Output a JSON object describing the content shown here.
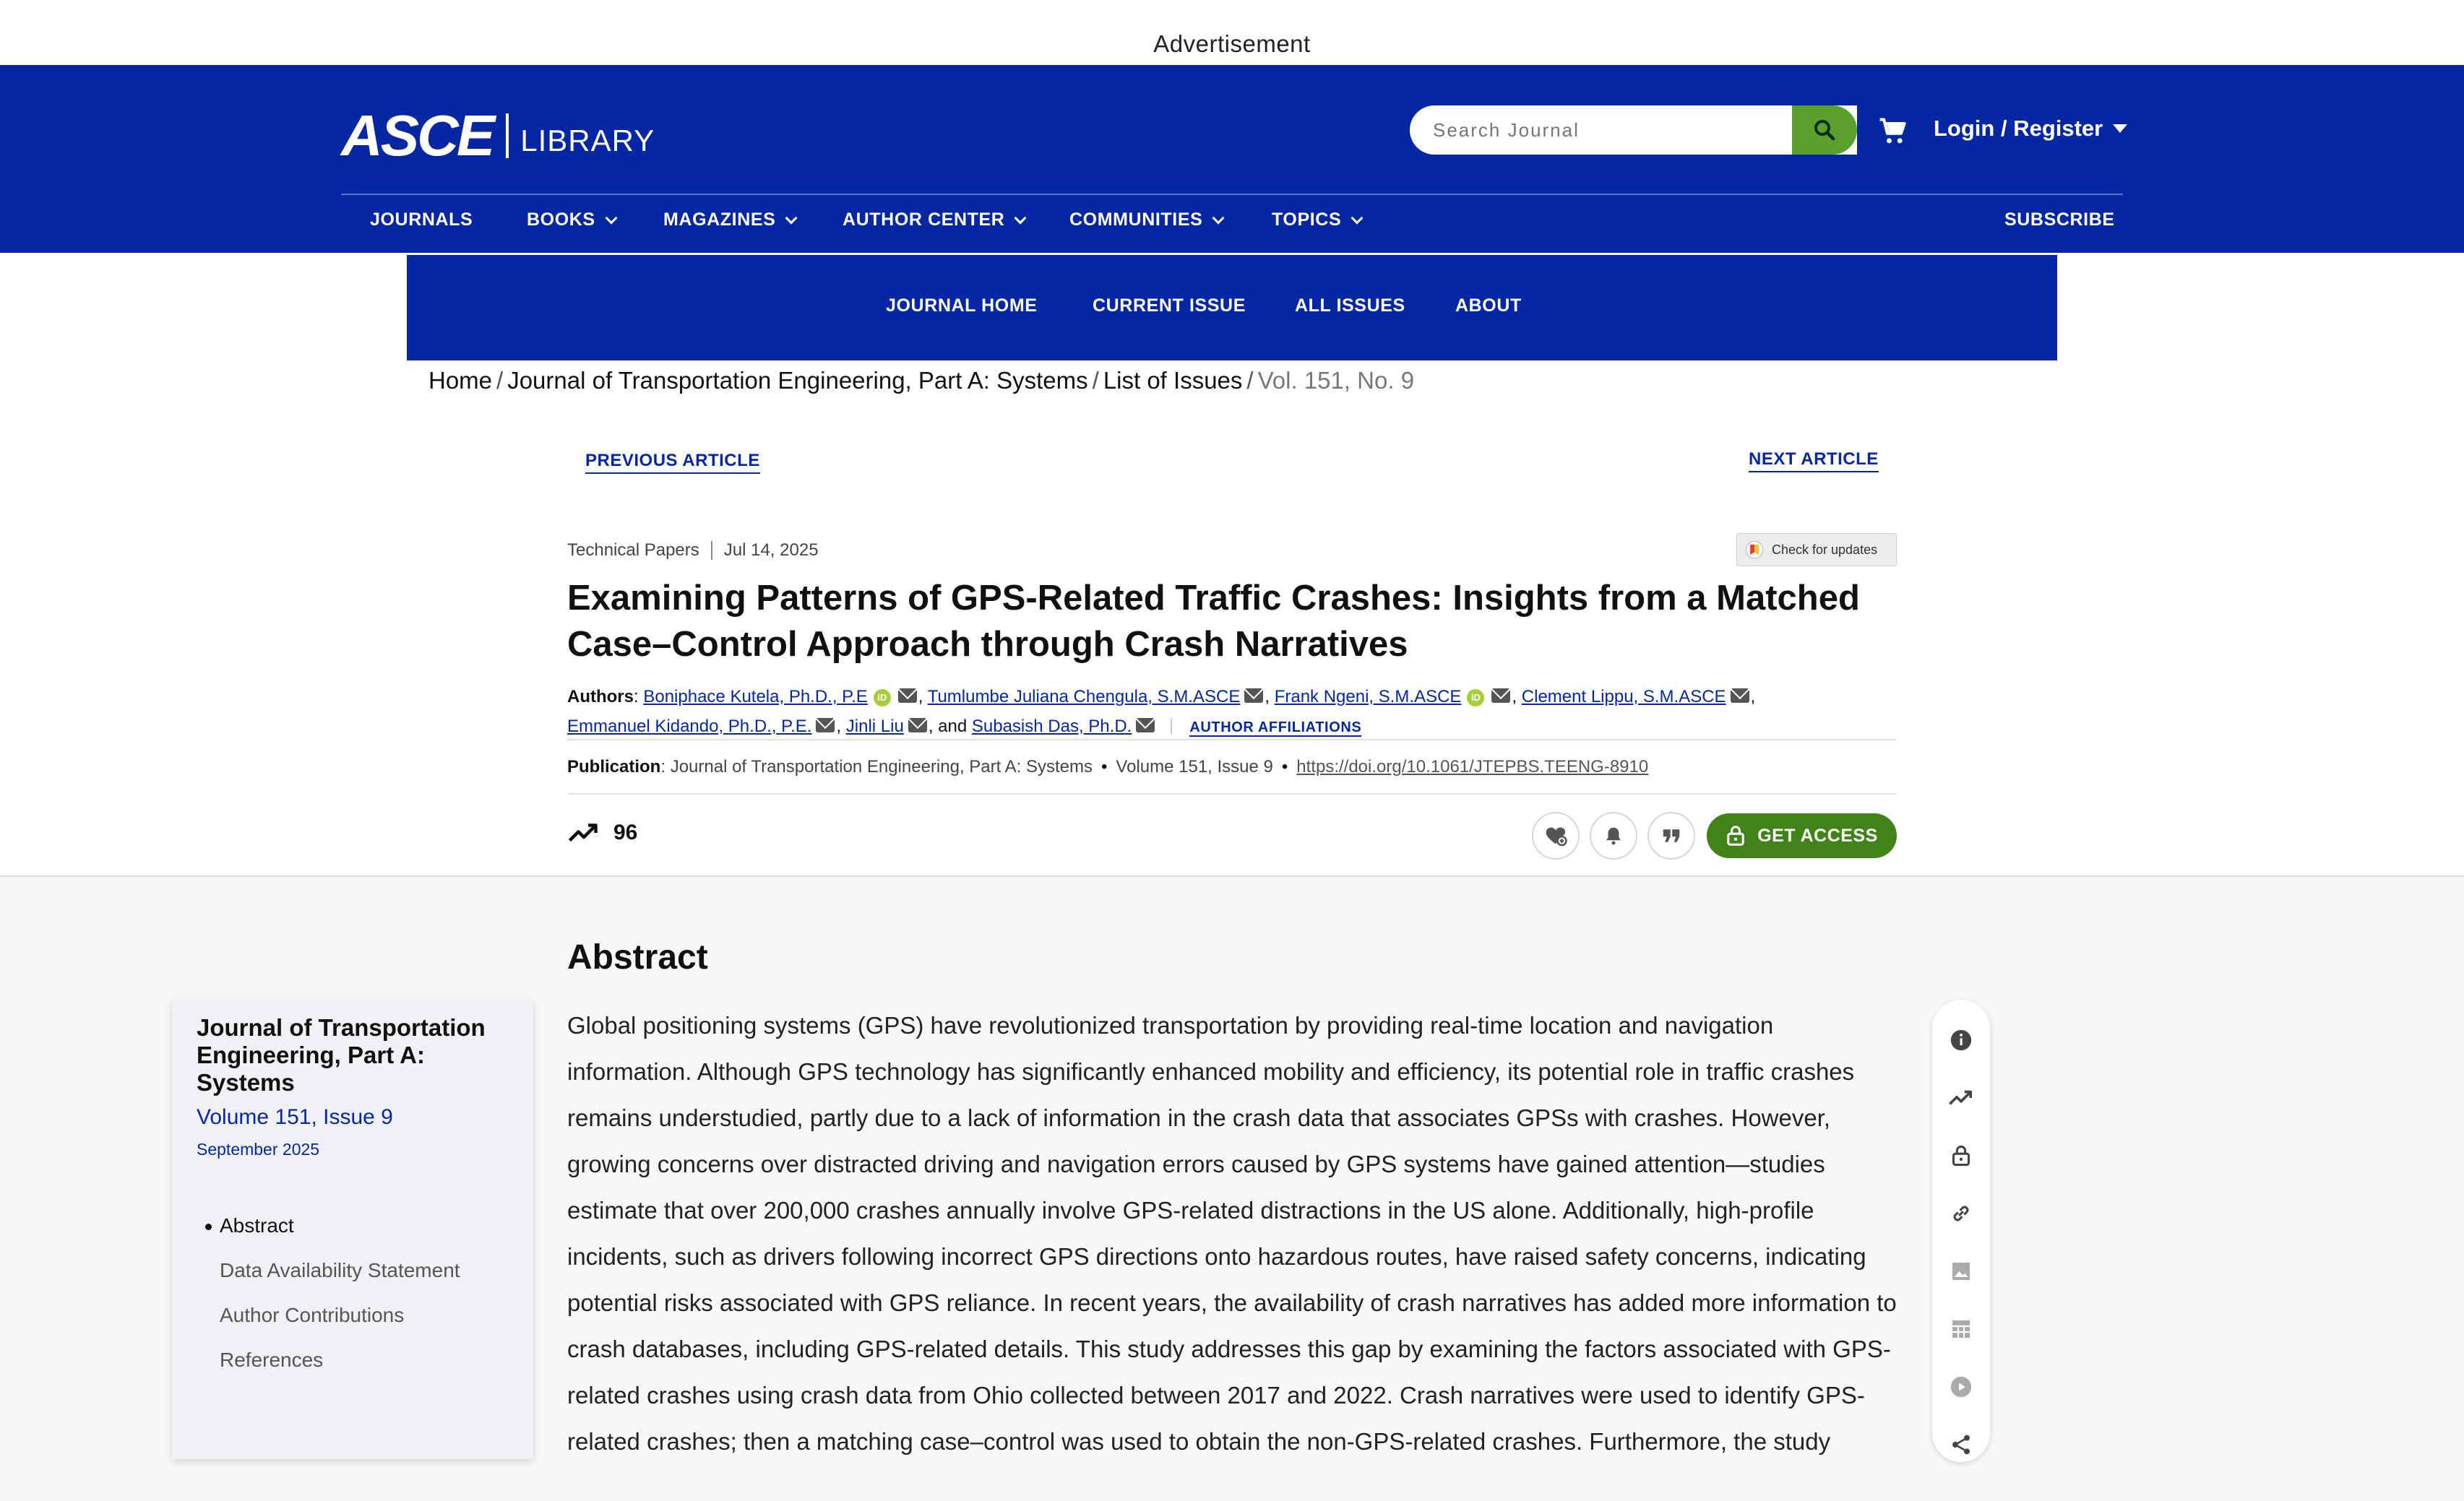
{
  "ad": {
    "label": "Advertisement"
  },
  "header": {
    "logo_main": "ASCE",
    "logo_sub": "LIBRARY",
    "search_placeholder": "Search Journal",
    "login_label": "Login / Register"
  },
  "mainnav": {
    "journals": "JOURNALS",
    "books": "BOOKS",
    "magazines": "MAGAZINES",
    "author_center": "AUTHOR CENTER",
    "communities": "COMMUNITIES",
    "topics": "TOPICS",
    "subscribe": "SUBSCRIBE"
  },
  "subnav": {
    "journal_home": "JOURNAL HOME",
    "current_issue": "CURRENT ISSUE",
    "all_issues": "ALL ISSUES",
    "about": "ABOUT"
  },
  "breadcrumb": {
    "home": "Home",
    "journal": "Journal of Transportation Engineering, Part A: Systems",
    "issues": "List of Issues",
    "current": "Vol. 151, No. 9"
  },
  "article_nav": {
    "previous": "PREVIOUS ARTICLE",
    "next": "NEXT ARTICLE"
  },
  "article": {
    "type": "Technical Papers",
    "date": "Jul 14, 2025",
    "check_updates": "Check for updates",
    "title": "Examining Patterns of GPS-Related Traffic Crashes: Insights from a Matched Case–Control Approach through Crash Narratives",
    "authors_label": "Authors",
    "authors": [
      "Boniphace Kutela, Ph.D., P.E",
      "Tumlumbe Juliana Chengula, S.M.ASCE",
      "Frank Ngeni, S.M.ASCE",
      "Clement Lippu, S.M.ASCE",
      "Emmanuel Kidando, Ph.D., P.E.",
      "Jinli Liu",
      "Subasish Das, Ph.D."
    ],
    "and_text": "and",
    "affiliations_label": "AUTHOR AFFILIATIONS",
    "publication_label": "Publication",
    "publication": "Journal of Transportation Engineering, Part A: Systems",
    "volume_issue": "Volume 151, Issue 9",
    "doi": "https://doi.org/10.1061/JTEPBS.TEENG-8910",
    "metric_count": "96",
    "get_access": "GET ACCESS"
  },
  "abstract": {
    "heading": "Abstract",
    "text": "Global positioning systems (GPS) have revolutionized transportation by providing real-time location and navigation information. Although GPS technology has significantly enhanced mobility and efficiency, its potential role in traffic crashes remains understudied, partly due to a lack of information in the crash data that associates GPSs with crashes. However, growing concerns over distracted driving and navigation errors caused by GPS systems have gained attention—studies estimate that over 200,000 crashes annually involve GPS-related distractions in the US alone. Additionally, high-profile incidents, such as drivers following incorrect GPS directions onto hazardous routes, have raised safety concerns, indicating potential risks associated with GPS reliance. In recent years, the availability of crash narratives has added more information to crash databases, including GPS-related details. This study addresses this gap by examining the factors associated with GPS-related crashes using crash data from Ohio collected between 2017 and 2022. Crash narratives were used to identify GPS-related crashes; then a matching case–control was used to obtain the non-GPS-related crashes. Furthermore, the study"
  },
  "toc": {
    "journal": "Journal of Transportation Engineering, Part A: Systems",
    "volume": "Volume 151, Issue 9",
    "date": "September 2025",
    "sections": [
      "Abstract",
      "Data Availability Statement",
      "Author Contributions",
      "References"
    ]
  },
  "colors": {
    "brand_blue": "#0527a4",
    "accent_green": "#5aa02c",
    "access_green": "#418219"
  }
}
